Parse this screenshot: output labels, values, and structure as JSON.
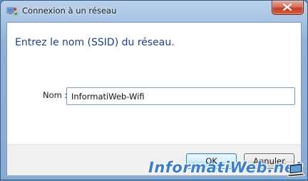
{
  "window": {
    "title": "Connexion à un réseau",
    "app_icon": "network-connection-icon",
    "close_icon": "close-icon"
  },
  "dialog": {
    "heading": "Entrez le nom (SSID) du réseau.",
    "ssid_label": "Nom :",
    "ssid_value": "InformatiWeb-Wifi"
  },
  "buttons": {
    "ok_label": "OK",
    "cancel_label": "Annuler"
  },
  "watermark": {
    "text": "InformatiWeb.net",
    "icon": "laptop-icon"
  },
  "colors": {
    "heading": "#1e3f8e",
    "close_button": "#c2402b",
    "default_button_border": "#3c7fb1",
    "watermark": "#3b7fd0"
  }
}
